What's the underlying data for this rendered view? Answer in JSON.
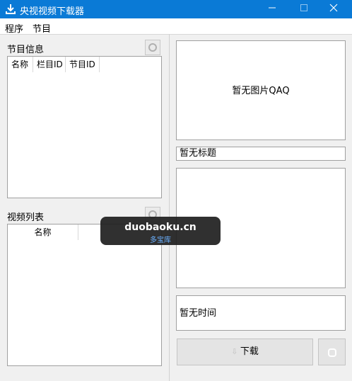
{
  "window": {
    "title": "央视视频下载器"
  },
  "menu": {
    "items": [
      "程序",
      "节目"
    ]
  },
  "program_info": {
    "label": "节目信息",
    "columns": [
      "名称",
      "栏目ID",
      "节目ID"
    ]
  },
  "video_list": {
    "label": "视频列表",
    "columns": [
      "名称"
    ]
  },
  "preview": {
    "image_placeholder": "暂无图片QAQ"
  },
  "details": {
    "title_placeholder": "暂无标题",
    "time_placeholder": "暂无时间"
  },
  "actions": {
    "download_label": "下载"
  },
  "watermark": {
    "domain": "duobaoku.cn",
    "name": "多宝库"
  },
  "colors": {
    "titlebar": "#0a7ad6",
    "window_bg": "#f0f0f0"
  }
}
